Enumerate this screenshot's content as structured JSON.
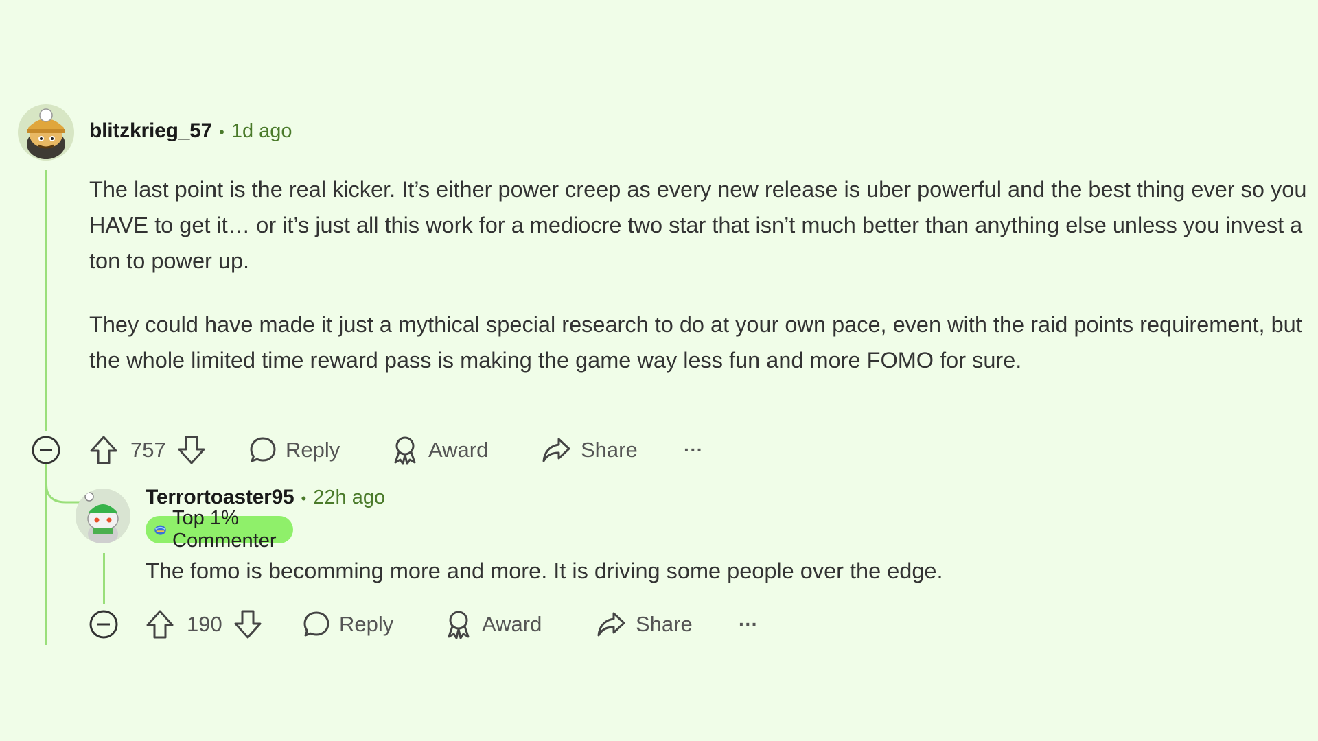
{
  "comments": [
    {
      "username": "blitzkrieg_57",
      "time": "1d ago",
      "paragraphs": [
        "The last point is the real kicker. It’s either power creep as every new release is uber powerful and the best thing ever so you HAVE to get it… or it’s just all this work for a mediocre two star that isn’t much better than anything else unless you invest a ton to power up.",
        "They could have made it just a mythical special research to do at your own pace, even with the raid points requirement, but the whole limited time reward pass is making the game way less fun and more FOMO for sure."
      ],
      "votes": "757",
      "actions": {
        "reply": "Reply",
        "award": "Award",
        "share": "Share",
        "more": "···"
      }
    },
    {
      "username": "Terrortoaster95",
      "time": "22h ago",
      "flair": "Top 1% Commenter",
      "text": "The fomo is becomming more and more. It is driving some people over the edge.",
      "votes": "190",
      "actions": {
        "reply": "Reply",
        "award": "Award",
        "share": "Share",
        "more": "···"
      }
    }
  ],
  "icons": [
    "collapse-icon",
    "upvote-icon",
    "downvote-icon",
    "reply-icon",
    "award-icon",
    "share-icon",
    "more-icon"
  ],
  "colors": {
    "background": "#f0fde8",
    "thread_line": "#9adf7a",
    "flair": "#8ff06a",
    "meta": "#4a7a2a"
  }
}
